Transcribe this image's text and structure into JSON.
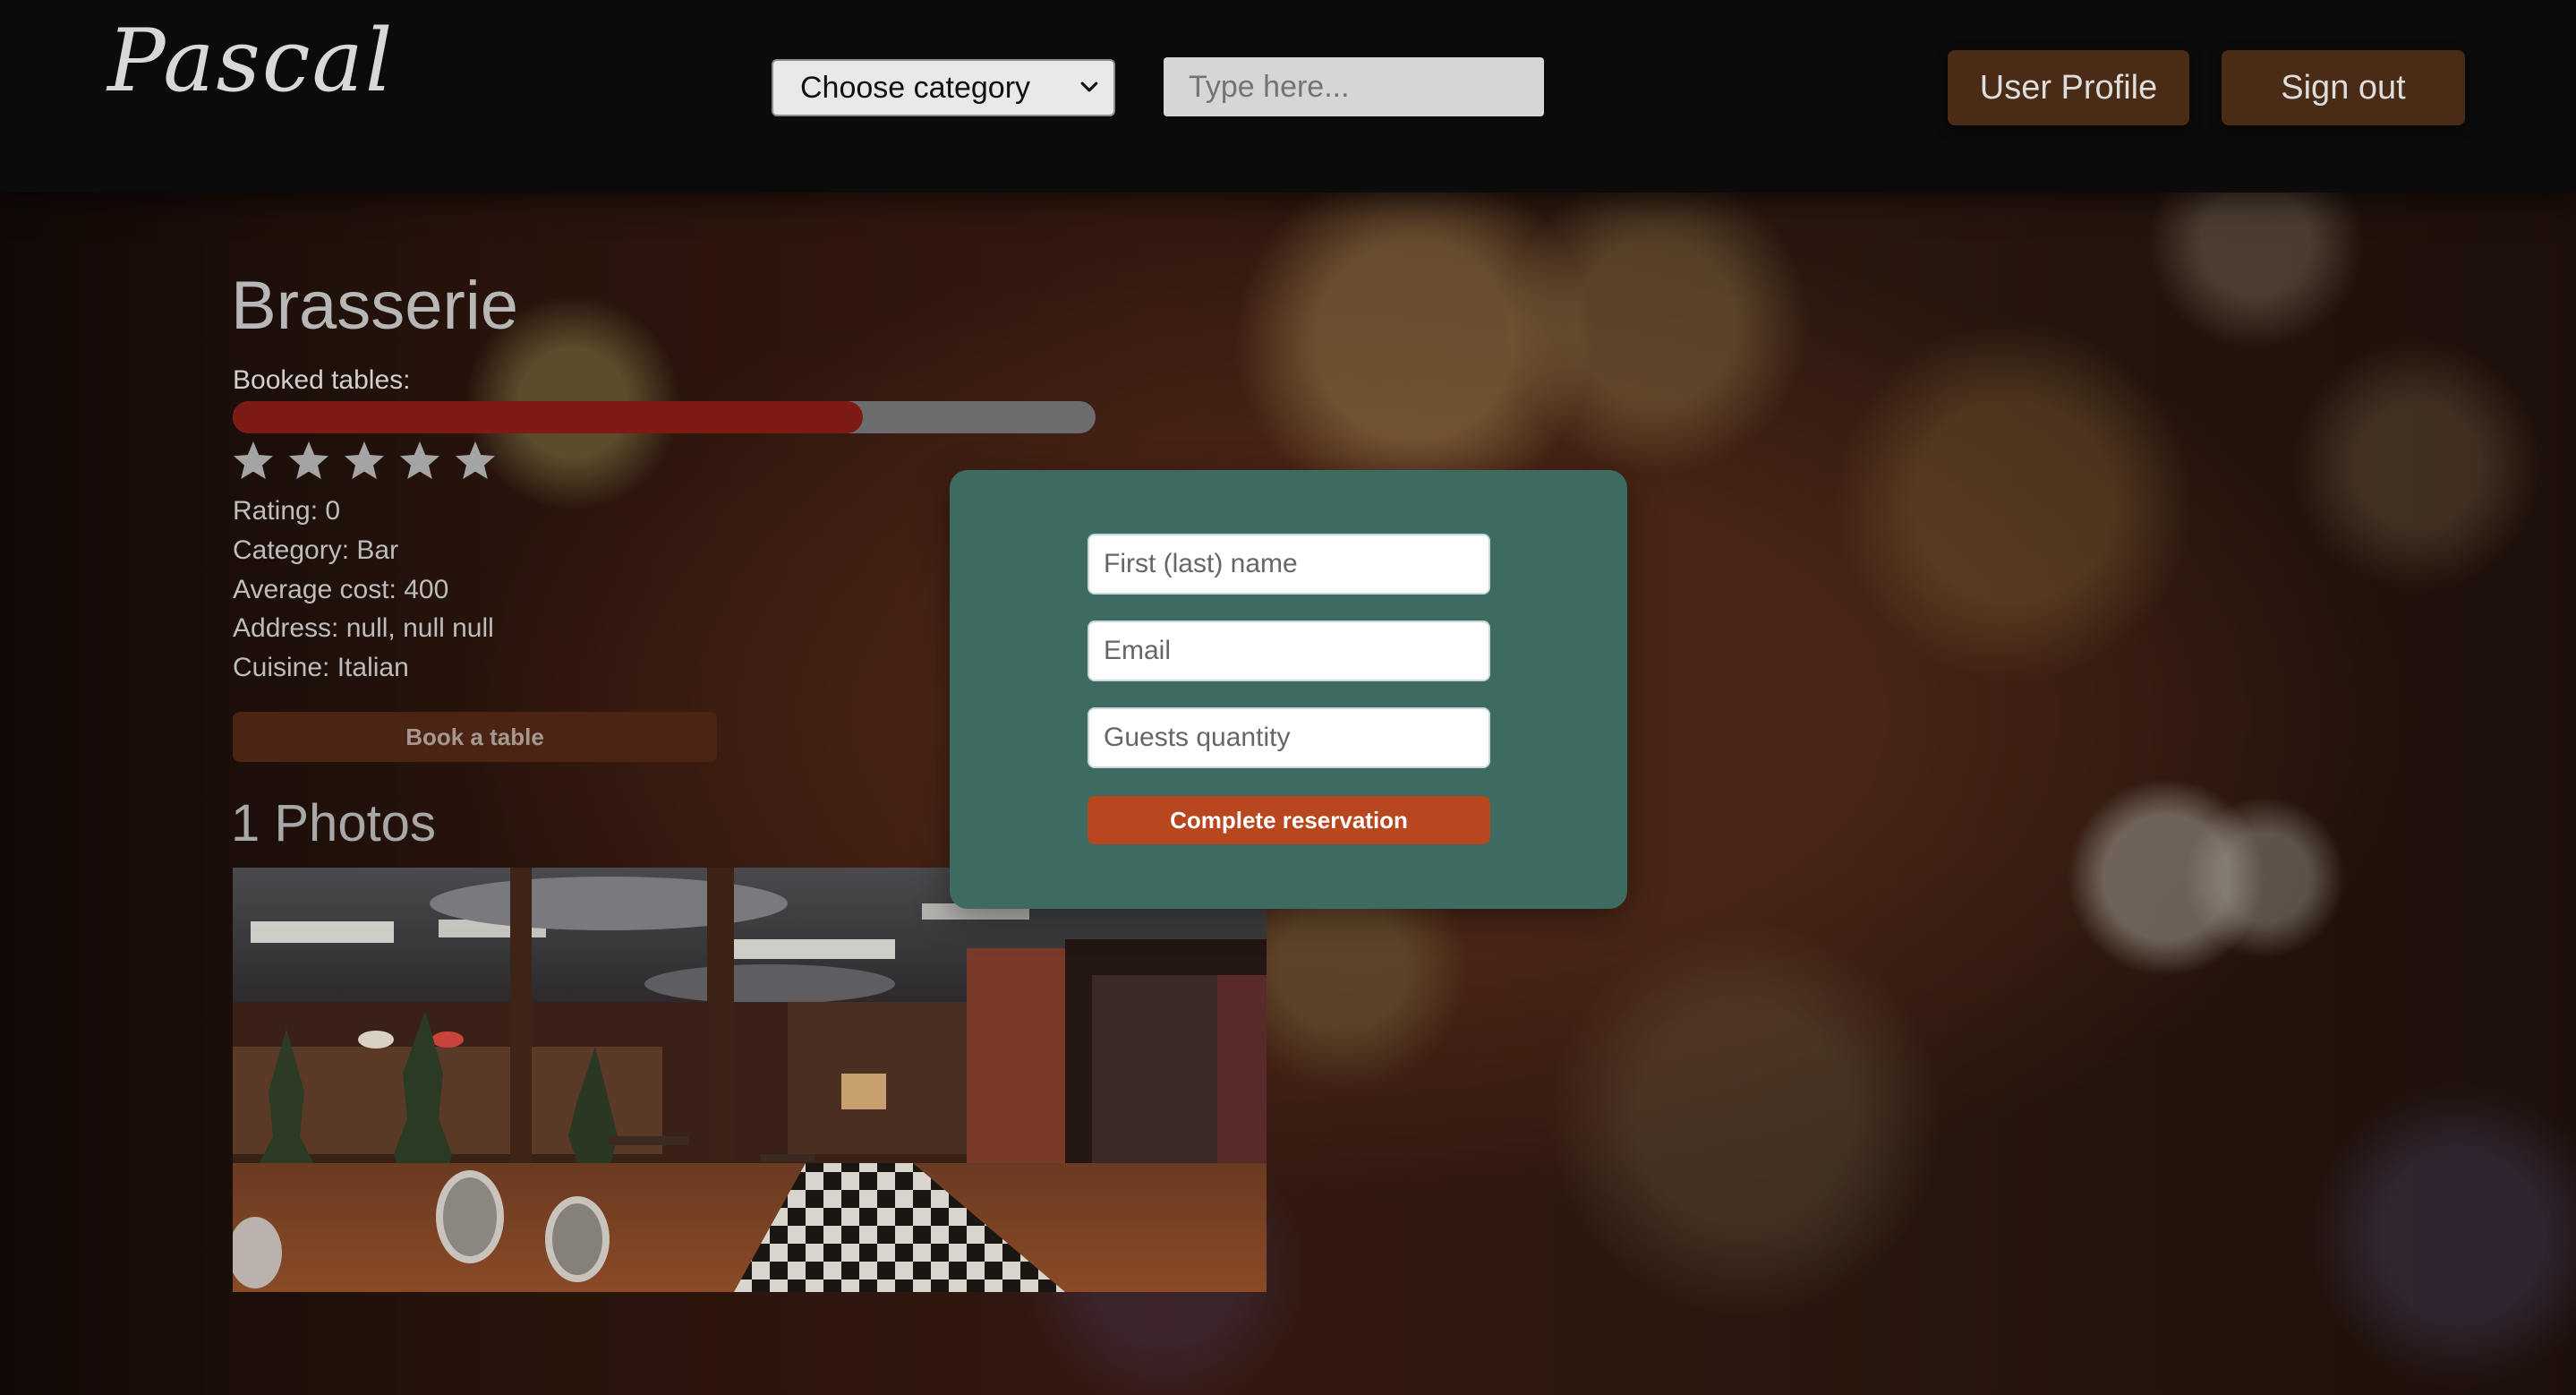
{
  "header": {
    "logo": "Pascal",
    "category_select": {
      "selected": "Choose category",
      "icon": "chevron-down-icon"
    },
    "search": {
      "placeholder": "Type here..."
    },
    "profile_label": "User Profile",
    "signout_label": "Sign out",
    "button_color": "#4a2b16"
  },
  "restaurant": {
    "name": "Brasserie",
    "booked_label": "Booked tables:",
    "booked_fraction": 0.73,
    "booked_color": "#7e1a14",
    "stars": {
      "total": 5,
      "filled": 0,
      "icon": "star-icon"
    },
    "info": {
      "rating": "Rating: 0",
      "category": "Category: Bar",
      "average_cost": "Average cost: 400",
      "address": "Address: null, null null",
      "cuisine": "Cuisine: Italian"
    },
    "book_label": "Book a table",
    "photos_heading": "1 Photos"
  },
  "reservation": {
    "name_placeholder": "First (last) name",
    "email_placeholder": "Email",
    "guests_placeholder": "Guests quantity",
    "submit_label": "Complete reservation",
    "panel_color": "#3d6b62",
    "submit_color": "#b8461f"
  }
}
